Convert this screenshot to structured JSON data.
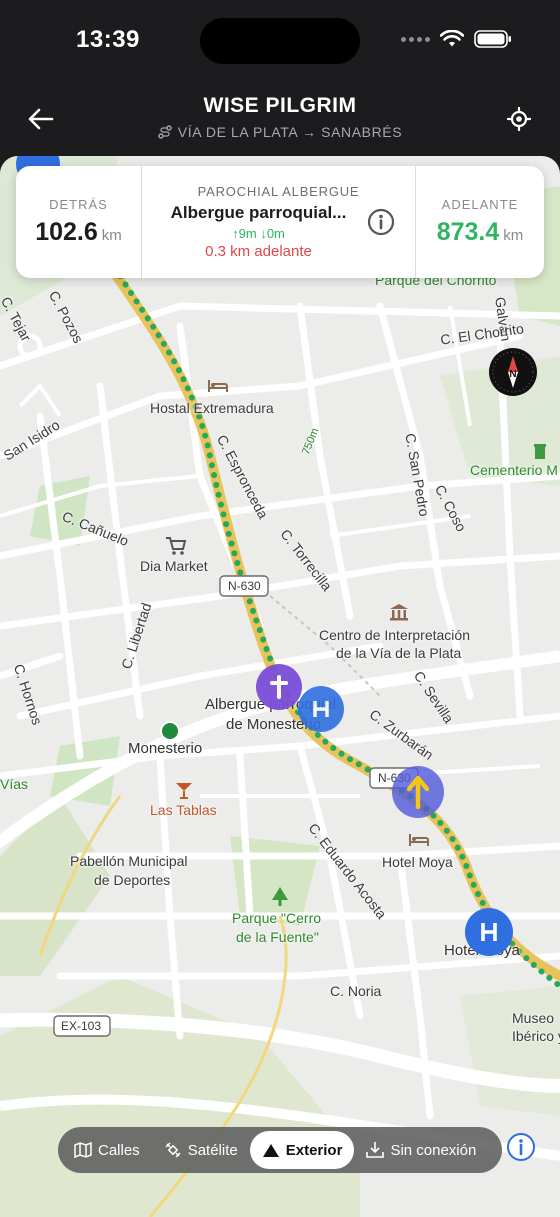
{
  "status_bar": {
    "time": "13:39"
  },
  "header": {
    "title": "WISE PILGRIM",
    "subtitle": "VÍA DE LA PLATA → SANABRÉS"
  },
  "info_card": {
    "behind_label": "DETRÁS",
    "behind_value": "102.6",
    "behind_unit": "km",
    "place_type": "PAROCHIAL ALBERGUE",
    "place_name": "Albergue parroquial...",
    "elev_up": "↑9m",
    "elev_down": "↓0m",
    "distance_ahead": "0.3 km adelante",
    "ahead_label": "ADELANTE",
    "ahead_value": "873.4",
    "ahead_unit": "km"
  },
  "map": {
    "labels": {
      "parque_chorrito": "Parque del Chorrito",
      "galvan": "Galván",
      "el_chorrito": "C. El Chorrito",
      "tejar": "C. Tejar",
      "pozos": "C. Pozos",
      "san_isidro": "San Isidro",
      "hostal": "Hostal Extremadura",
      "espronceda": "C. Espronceda",
      "meter_750": "750m",
      "san_pedro": "C. San Pedro",
      "coso": "C. Coso",
      "cementerio": "Cementerio M",
      "canuelo": "C. Cañuelo",
      "torrecilla": "C. Torrecilla",
      "dia_market": "Dia Market",
      "n630_a": "N-630",
      "n630_b": "N-630",
      "centro_1": "Centro de Interpretación",
      "centro_2": "de la Vía de la Plata",
      "libertad": "C. Libertad",
      "hornos": "C. Hornos",
      "sevilla": "C. Sevilla",
      "albergue_1": "Albergue parroquial",
      "albergue_2": "de Monesterio",
      "zurbaran": "C. Zurbarán",
      "monesterio": "Monesterio",
      "vias": "Vías",
      "las_tablas": "Las Tablas",
      "eduardo_acosta": "C. Eduardo Acosta",
      "hotel_moya_a": "Hotel Moya",
      "pabellon_1": "Pabellón Municipal",
      "pabellon_2": "de Deportes",
      "parque_cerro_1": "Parque \"Cerro",
      "parque_cerro_2": "de la Fuente\"",
      "hotel_moya_b": "Hotel Moya",
      "noria": "C. Noria",
      "ex103": "EX-103",
      "museo_1": "Museo",
      "museo_2": "Ibérico y"
    }
  },
  "layers": {
    "calles": "Calles",
    "satelite": "Satélite",
    "exterior": "Exterior",
    "sin_conexion": "Sin conexión"
  },
  "colors": {
    "accent_green": "#2fb462",
    "alert_red": "#e04848",
    "route_yellow": "#e8c25a",
    "pin_purple": "#7b4fd9",
    "pin_blue": "#2f6fe0"
  }
}
